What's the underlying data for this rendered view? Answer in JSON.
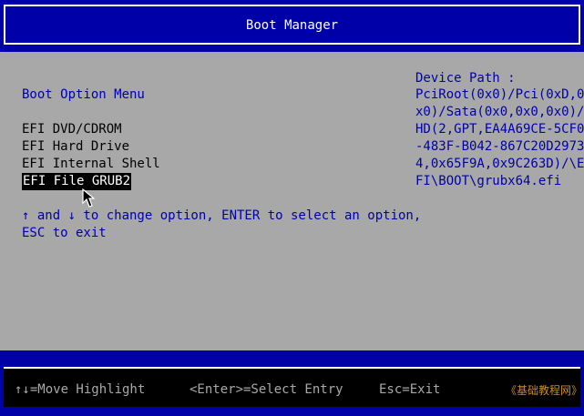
{
  "header": {
    "title": "Boot Manager"
  },
  "menu": {
    "title": "Boot Option Menu",
    "options": [
      {
        "label": "EFI DVD/CDROM",
        "selected": false
      },
      {
        "label": "EFI Hard Drive",
        "selected": false
      },
      {
        "label": "EFI Internal Shell",
        "selected": false
      },
      {
        "label": "EFI File GRUB2",
        "selected": true
      }
    ],
    "help_line1": "↑ and ↓ to change option, ENTER to select an option,",
    "help_line2": "ESC to exit"
  },
  "device_path": {
    "title": "Device Path :",
    "lines": [
      "PciRoot(0x0)/Pci(0xD,0",
      "x0)/Sata(0x0,0x0,0x0)/",
      "HD(2,GPT,EA4A69CE-5CF0",
      "-483F-B042-867C20D2973",
      "4,0x65F9A,0x9C263D)/\\E",
      "FI\\BOOT\\grubx64.efi"
    ]
  },
  "footer": {
    "move": "↑↓=Move Highlight",
    "enter": "<Enter>=Select Entry",
    "exit": "Esc=Exit",
    "brand": "《基础教程网》"
  },
  "colors": {
    "blue": "#0000a8",
    "gray": "#a8a8a8",
    "black": "#000000",
    "white": "#ffffff"
  }
}
